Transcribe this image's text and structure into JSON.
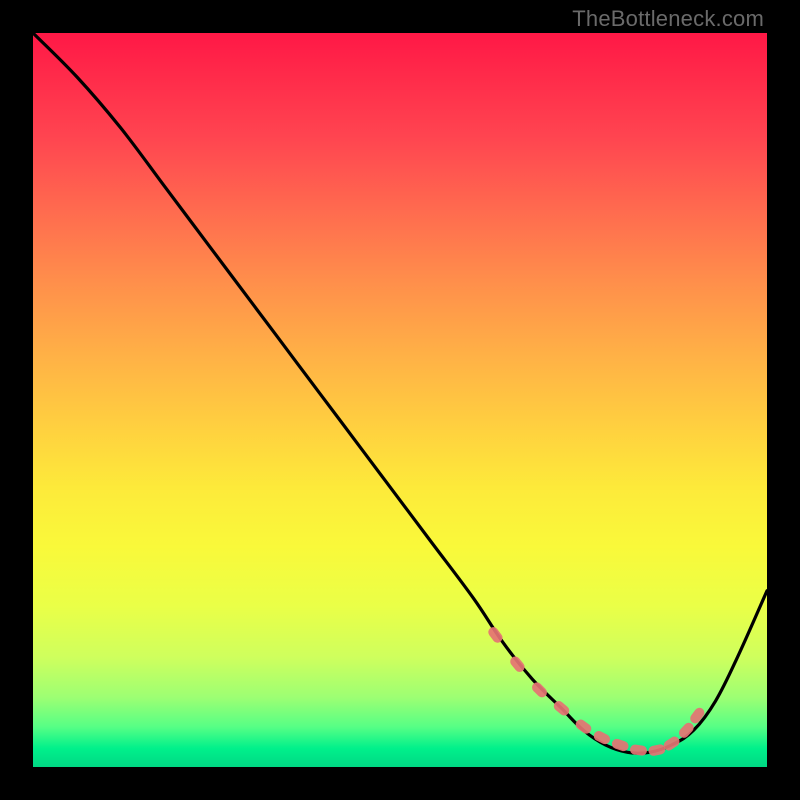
{
  "watermark": "TheBottleneck.com",
  "colors": {
    "marker": "#e57373",
    "line": "#000000"
  },
  "chart_data": {
    "type": "line",
    "title": "",
    "xlabel": "",
    "ylabel": "",
    "xlim": [
      0,
      100
    ],
    "ylim": [
      0,
      100
    ],
    "grid": false,
    "legend": false,
    "series": [
      {
        "name": "bottleneck-curve",
        "x": [
          0,
          6,
          12,
          18,
          24,
          30,
          36,
          42,
          48,
          54,
          60,
          64,
          68,
          72,
          75,
          78,
          81,
          84,
          87,
          90,
          93,
          96,
          100
        ],
        "y": [
          100,
          94,
          87,
          79,
          71,
          63,
          55,
          47,
          39,
          31,
          23,
          17,
          12,
          8,
          5,
          3,
          2,
          2,
          3,
          5,
          9,
          15,
          24
        ]
      }
    ],
    "markers": {
      "name": "highlight-dots",
      "x": [
        63,
        66,
        69,
        72,
        75,
        77.5,
        80,
        82.5,
        85,
        87,
        89,
        90.5
      ],
      "y": [
        18,
        14,
        10.5,
        8,
        5.5,
        4,
        3,
        2.3,
        2.3,
        3.2,
        5,
        7
      ]
    }
  }
}
